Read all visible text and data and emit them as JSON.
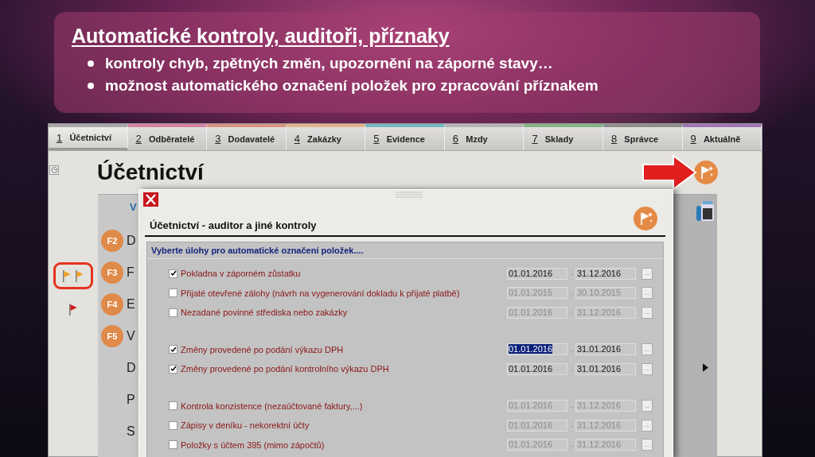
{
  "slide": {
    "title": "Automatické kontroly, auditoři, příznaky",
    "bullets": [
      "kontroly chyb, zpětných změn, upozornění na záporné stavy…",
      "možnost automatického označení položek pro zpracování příznakem"
    ]
  },
  "tabs": [
    {
      "number": "1",
      "label": "Účetnictví",
      "color": "#a8a8a8",
      "selected": true
    },
    {
      "number": "2",
      "label": "Odběratelé",
      "color": "#d682a4",
      "selected": false
    },
    {
      "number": "3",
      "label": "Dodavatelé",
      "color": "#d99480",
      "selected": false
    },
    {
      "number": "4",
      "label": "Zakázky",
      "color": "#e2b48c",
      "selected": false
    },
    {
      "number": "5",
      "label": "Evidence",
      "color": "#74b7c2",
      "selected": false
    },
    {
      "number": "6",
      "label": "Mzdy",
      "color": "#b4b4b4",
      "selected": false
    },
    {
      "number": "7",
      "label": "Sklady",
      "color": "#84b486",
      "selected": false
    },
    {
      "number": "8",
      "label": "Správce",
      "color": "#8e8e8e",
      "selected": false
    },
    {
      "number": "9",
      "label": "Aktuálně",
      "color": "#a274b4",
      "selected": false
    }
  ],
  "module": {
    "title": "Účetnictví"
  },
  "flags": [
    {
      "highlighted": true,
      "items": [
        {
          "color": "#f0a020"
        },
        {
          "color": "#f0a020"
        }
      ]
    },
    {
      "highlighted": false,
      "items": [
        {
          "color": "#d01818"
        }
      ]
    }
  ],
  "panel": {
    "heading": "V",
    "items": [
      {
        "key": "F2",
        "label": "D"
      },
      {
        "key": "F3",
        "label": "F"
      },
      {
        "key": "F4",
        "label": "E"
      },
      {
        "key": "F5",
        "label": "V"
      },
      {
        "label": "D"
      },
      {
        "label": "P"
      },
      {
        "label": "S"
      }
    ]
  },
  "dialog": {
    "title": "Účetnictví - auditor a jiné kontroly",
    "section": "Vyberte úlohy pro automatické označení položek....",
    "groups": [
      {
        "rows": [
          {
            "label": "Pokladna v záporném zůstatku",
            "checked": true,
            "from": "01.01.2016",
            "to": "31.12.2016",
            "separator": "-",
            "picker": "...",
            "highlighted": false
          },
          {
            "label": "Přijaté otevřené zálohy (návrh na vygenerování dokladu k přijaté platbě)",
            "checked": false,
            "from": "01.01.2015",
            "to": "30.10.2015",
            "separator": "-",
            "picker": "...",
            "highlighted": false
          },
          {
            "label": "Nezadané povinné střediska nebo zakázky",
            "checked": false,
            "from": "01.01.2016",
            "to": "31.12.2016",
            "separator": "-",
            "picker": "...",
            "highlighted": false
          }
        ]
      },
      {
        "rows": [
          {
            "label": "Změny provedené po podání výkazu DPH",
            "checked": true,
            "from": "01.01.2016",
            "to": "31.01.2016",
            "separator": "-",
            "picker": "...",
            "highlighted": true
          },
          {
            "label": "Změny provedené po podání kontrolního výkazu DPH",
            "checked": true,
            "from": "01.01.2016",
            "to": "31.01.2016",
            "separator": "-",
            "picker": "...",
            "highlighted": false
          }
        ]
      },
      {
        "rows": [
          {
            "label": "Kontrola konzistence (nezaúčtované faktury,...)",
            "checked": false,
            "from": "01.01.2016",
            "to": "31.12.2016",
            "separator": "-",
            "picker": "...",
            "highlighted": false
          },
          {
            "label": "Zápisy v deníku - nekorektní účty",
            "checked": false,
            "from": "01.01.2016",
            "to": "31.12.2016",
            "separator": "-",
            "picker": "...",
            "highlighted": false
          },
          {
            "label": "Položky s účtem 395 (mimo zápočtů)",
            "checked": false,
            "from": "01.01.2016",
            "to": "31.12.2016",
            "separator": "-",
            "picker": "...",
            "highlighted": false
          }
        ]
      }
    ]
  }
}
